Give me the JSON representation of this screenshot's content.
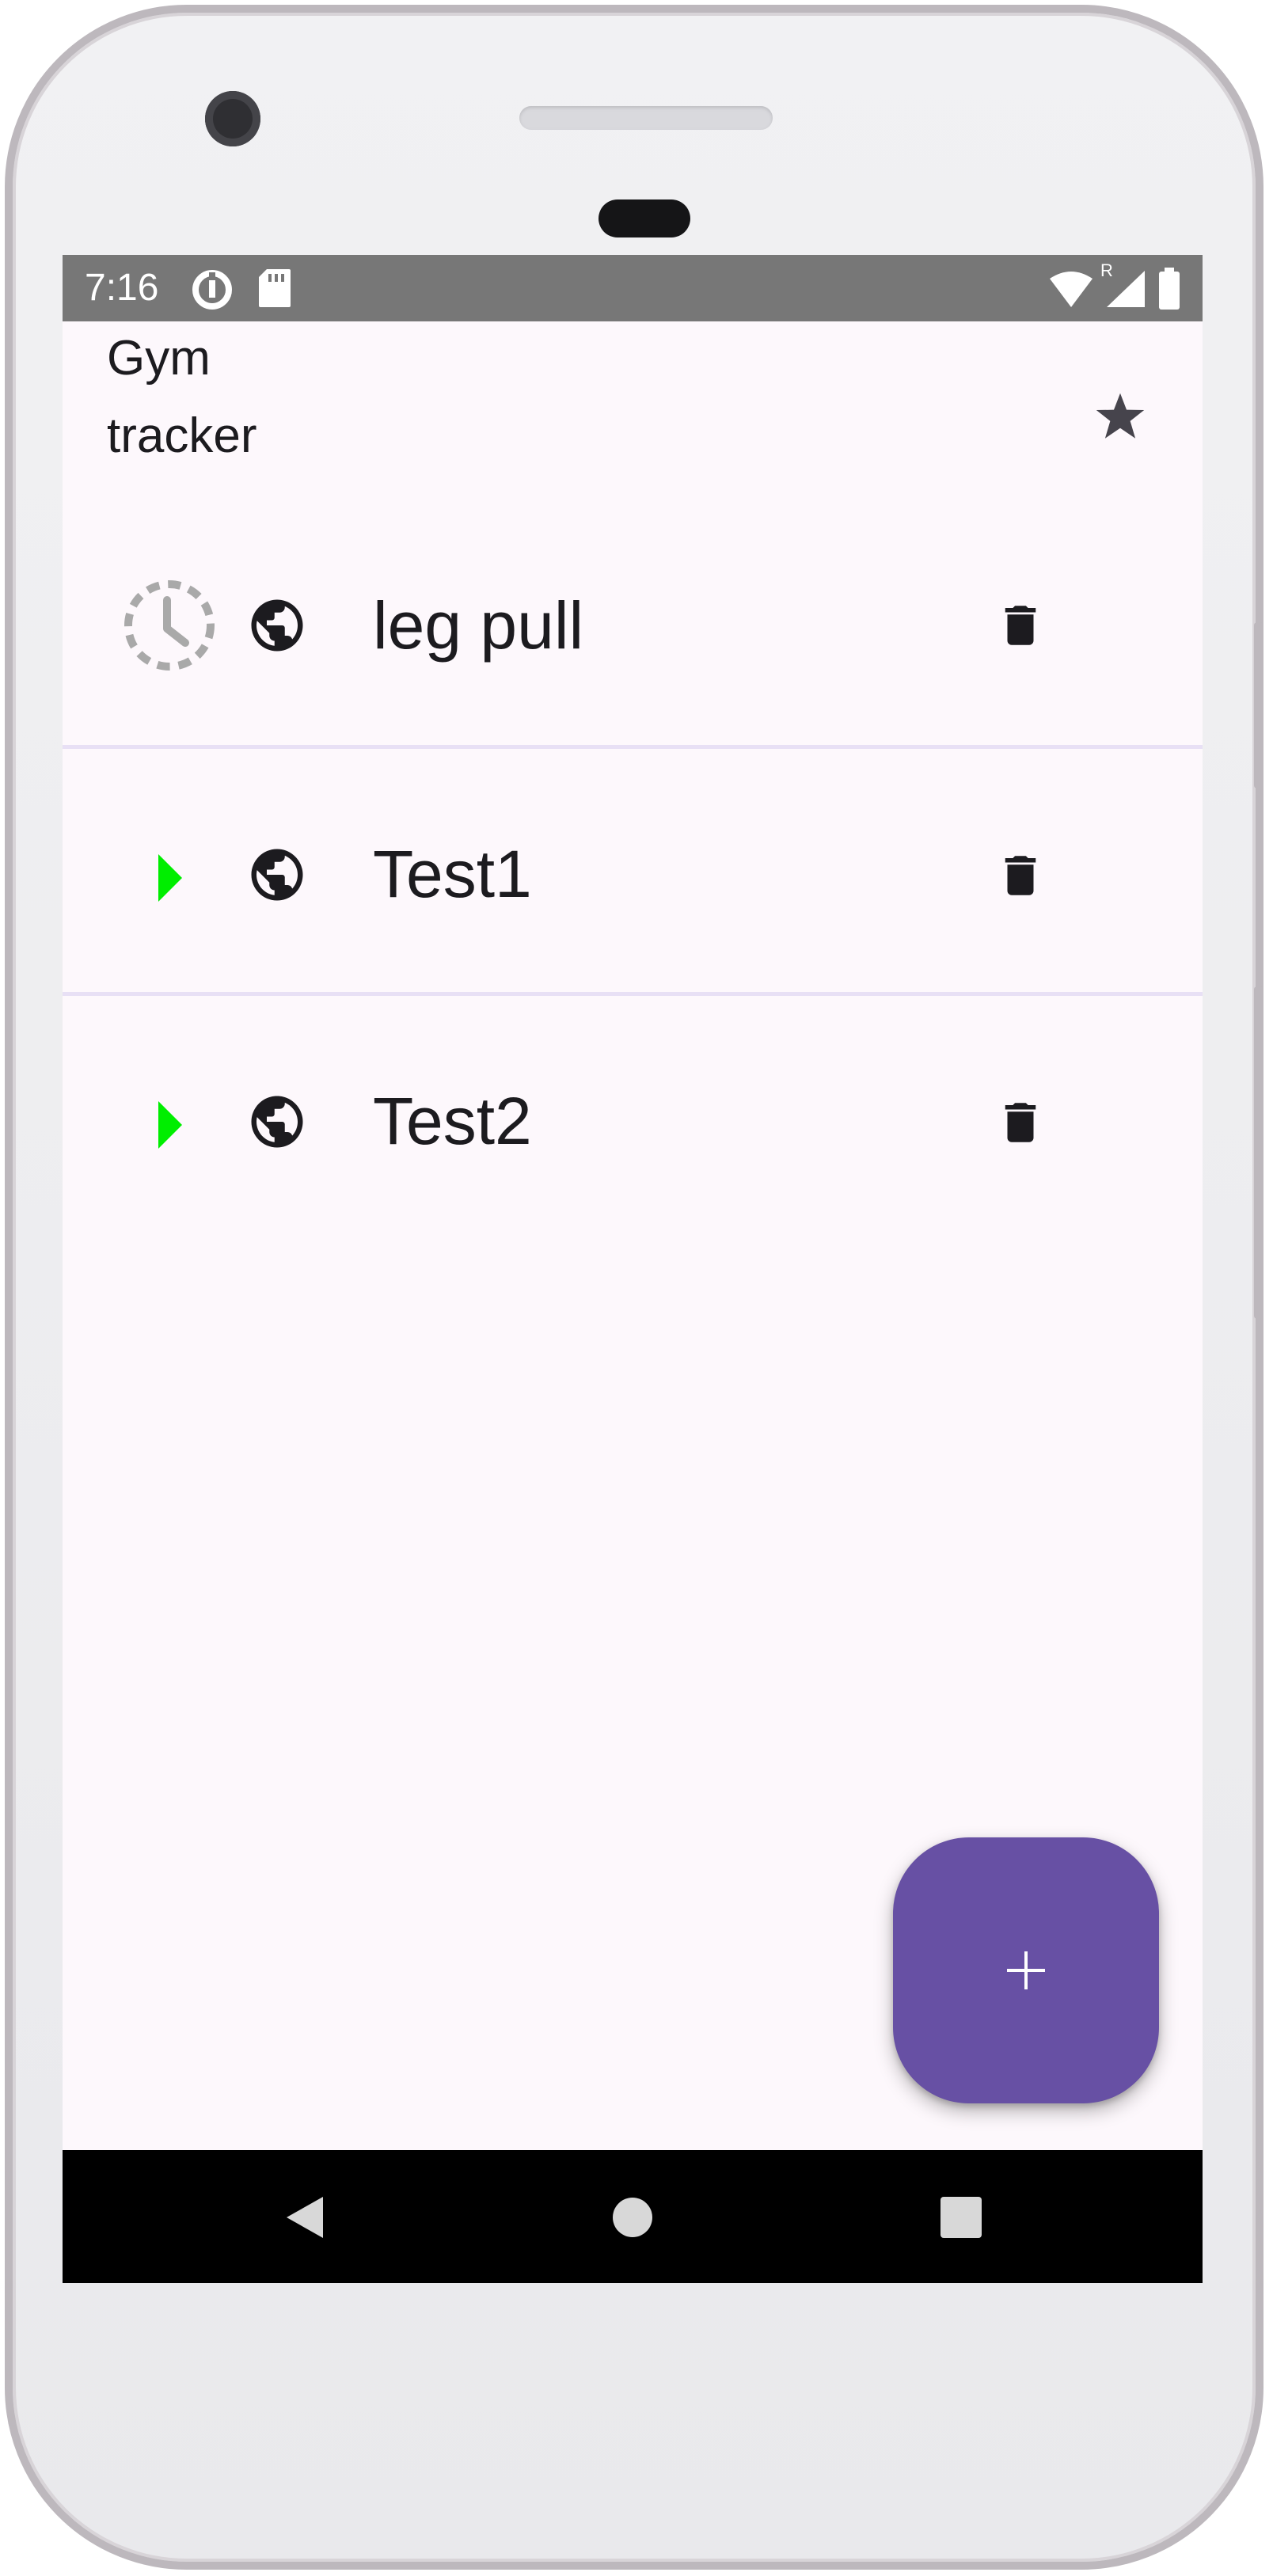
{
  "status_bar": {
    "time": "7:16",
    "icons": [
      "data-saver-icon",
      "sd-card-icon",
      "wifi-icon",
      "roaming-indicator",
      "signal-icon",
      "battery-icon"
    ],
    "roaming_label": "R"
  },
  "app_bar": {
    "title": "Gym tracker",
    "action_icon": "star-icon"
  },
  "workouts": [
    {
      "name": "leg pull",
      "status_icon": "scheduled-clock-icon",
      "visibility_icon": "globe-icon",
      "action_icon": "delete-icon"
    },
    {
      "name": "Test1",
      "status_icon": "play-icon",
      "visibility_icon": "globe-icon",
      "action_icon": "delete-icon"
    },
    {
      "name": "Test2",
      "status_icon": "play-icon",
      "visibility_icon": "globe-icon",
      "action_icon": "delete-icon"
    }
  ],
  "fab": {
    "icon": "add-icon",
    "label": "+"
  },
  "nav_bar": {
    "buttons": [
      "back-icon",
      "home-icon",
      "recents-icon"
    ]
  },
  "colors": {
    "status_bar": "#777777",
    "background": "#fdf8fc",
    "divider": "#e8e0f5",
    "fab": "#6750a4",
    "play": "#00ee00",
    "clock": "#a9a9a9",
    "text": "#1c1b1f"
  }
}
